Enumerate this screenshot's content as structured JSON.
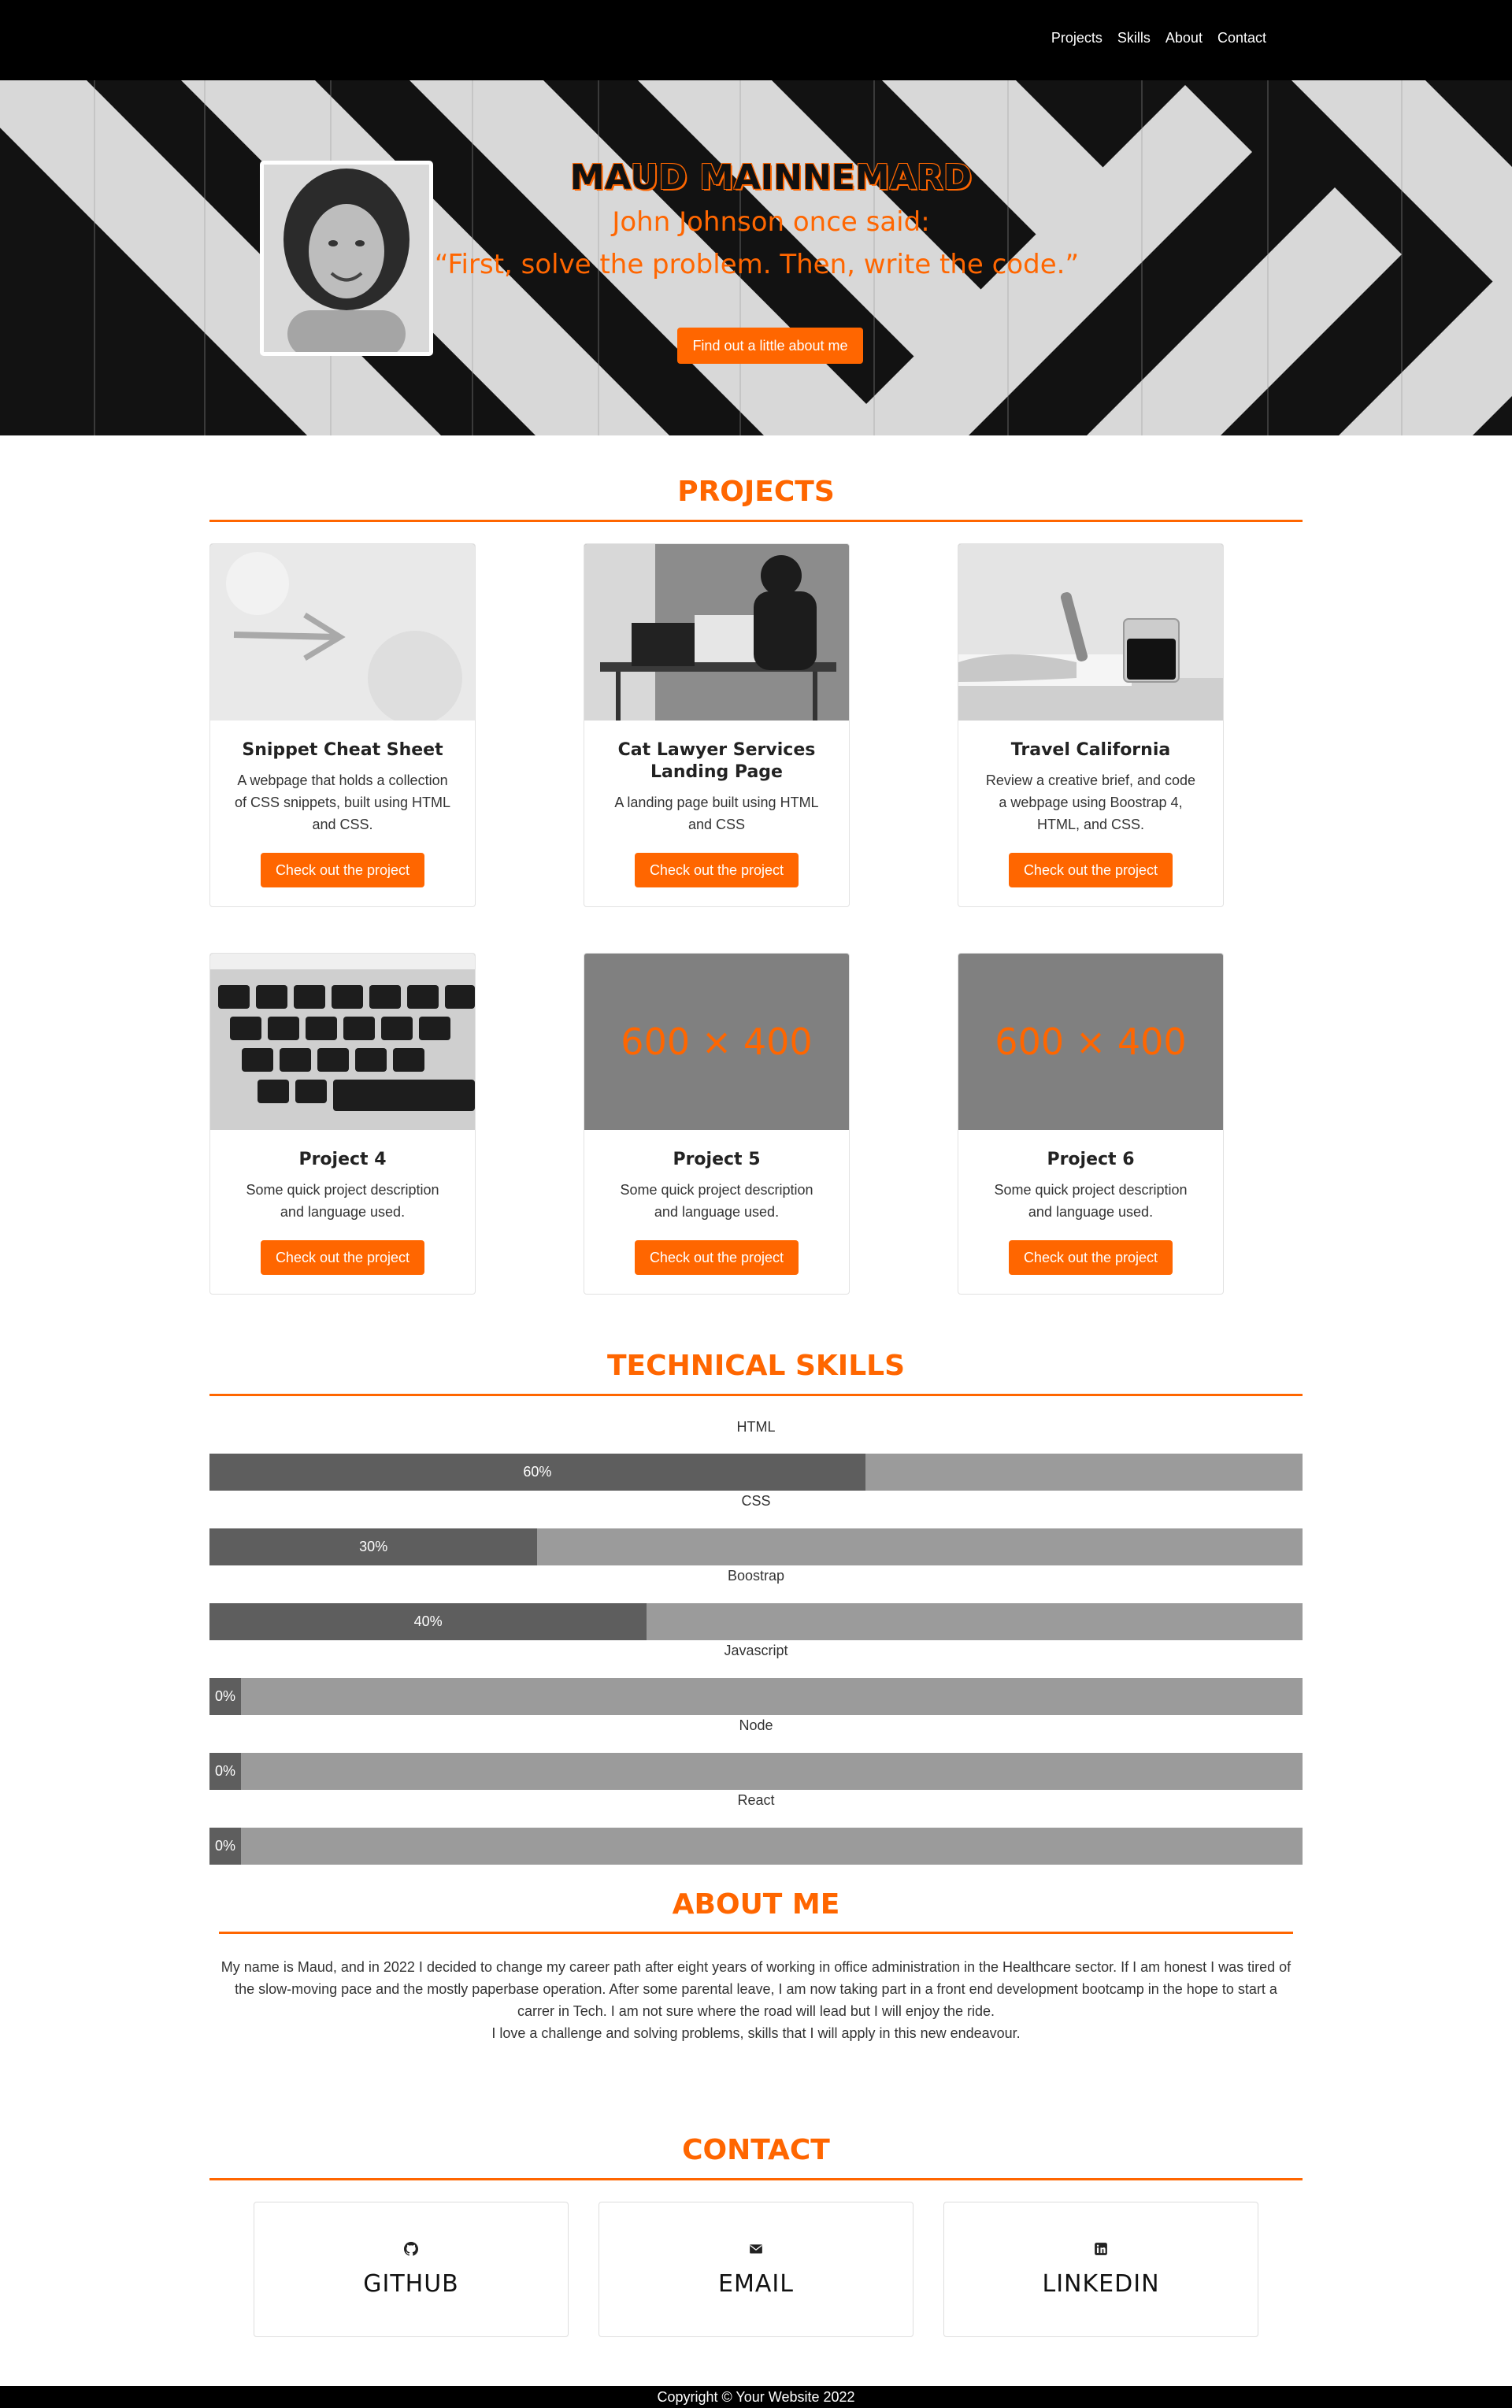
{
  "nav": {
    "links": [
      "Projects",
      "Skills",
      "About",
      "Contact"
    ]
  },
  "hero": {
    "name": "MAUD MAINNEMARD",
    "said": "John Johnson once said:",
    "quote": "“First, solve the problem. Then, write the code.”",
    "button": "Find out a little about me"
  },
  "projects": {
    "title": "PROJECTS",
    "button_label": "Check out the project",
    "items": [
      {
        "title": "Snippet Cheat Sheet",
        "desc": "A webpage that holds a collection of CSS snippets, built using HTML and CSS.",
        "image": "arrow-photo"
      },
      {
        "title": "Cat Lawyer Services Landing Page",
        "desc": "A landing page built using HTML and CSS",
        "image": "office-photo"
      },
      {
        "title": "Travel California",
        "desc": "Review a creative brief, and code a webpage using Boostrap 4, HTML, and CSS.",
        "image": "coffee-photo"
      },
      {
        "title": "Project 4",
        "desc": "Some quick project description and language used.",
        "image": "keyboard-photo"
      },
      {
        "title": "Project 5",
        "desc": "Some quick project description and language used.",
        "image": "placeholder",
        "placeholder": "600 × 400"
      },
      {
        "title": "Project 6",
        "desc": "Some quick project description and language used.",
        "image": "placeholder",
        "placeholder": "600 × 400"
      }
    ]
  },
  "skills": {
    "title": "TECHNICAL SKILLS",
    "items": [
      {
        "name": "HTML",
        "percent": 60,
        "label": "60%"
      },
      {
        "name": "CSS",
        "percent": 30,
        "label": "30%"
      },
      {
        "name": "Boostrap",
        "percent": 40,
        "label": "40%"
      },
      {
        "name": "Javascript",
        "percent": 0,
        "label": "0%"
      },
      {
        "name": "Node",
        "percent": 0,
        "label": "0%"
      },
      {
        "name": "React",
        "percent": 0,
        "label": "0%"
      }
    ]
  },
  "about": {
    "title": "ABOUT ME",
    "paragraph1": "My name is Maud, and in 2022 I decided to change my career path after eight years of working in office administration in the Healthcare sector. If I am honest I was tired of the slow-moving pace and the mostly paperbase operation. After some parental leave, I am now taking part in a front end development bootcamp in the hope to start a carrer in Tech. I am not sure where the road will lead but I will enjoy the ride.",
    "paragraph2": "I love a challenge and solving problems, skills that I will apply in this new endeavour."
  },
  "contact": {
    "title": "CONTACT",
    "items": [
      {
        "label": "GITHUB",
        "icon": "github-icon"
      },
      {
        "label": "EMAIL",
        "icon": "envelope-icon"
      },
      {
        "label": "LINKEDIN",
        "icon": "linkedin-icon"
      }
    ]
  },
  "footer": {
    "text": "Copyright © Your Website 2022"
  },
  "colors": {
    "accent": "#ff6600",
    "nav_bg": "#000000",
    "bar_fill": "#5e5e5e",
    "bar_track": "#9b9b9b"
  }
}
